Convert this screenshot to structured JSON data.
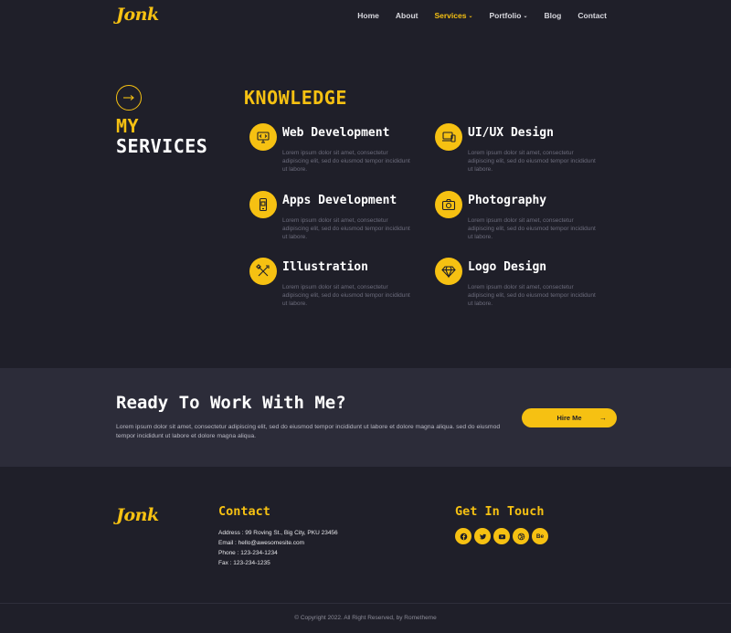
{
  "brand": {
    "logo": "Jonk",
    "accent": "#f6c112",
    "background": "#1f1f29"
  },
  "nav": {
    "items": [
      {
        "label": "Home",
        "active": false,
        "dropdown": false
      },
      {
        "label": "About",
        "active": false,
        "dropdown": false
      },
      {
        "label": "Services",
        "active": true,
        "dropdown": true
      },
      {
        "label": "Portfolio",
        "active": false,
        "dropdown": true
      },
      {
        "label": "Blog",
        "active": false,
        "dropdown": false
      },
      {
        "label": "Contact",
        "active": false,
        "dropdown": false
      }
    ]
  },
  "intro": {
    "line1": "MY",
    "line2": "SERVICES",
    "arrow_icon": "arrow-right-icon"
  },
  "knowledge": {
    "heading": "KNOWLEDGE",
    "services": [
      {
        "title": "Web Development",
        "icon": "monitor-code-icon",
        "desc": "Lorem ipsum dolor sit amet, consectetur adipiscing elit, sed do eiusmod tempor incididunt ut labore."
      },
      {
        "title": "UI/UX Design",
        "icon": "devices-icon",
        "desc": "Lorem ipsum dolor sit amet, consectetur adipiscing elit, sed do eiusmod tempor incididunt ut labore."
      },
      {
        "title": "Apps Development",
        "icon": "smartphone-icon",
        "desc": "Lorem ipsum dolor sit amet, consectetur adipiscing elit, sed do eiusmod tempor incididunt ut labore."
      },
      {
        "title": "Photography",
        "icon": "camera-icon",
        "desc": "Lorem ipsum dolor sit amet, consectetur adipiscing elit, sed do eiusmod tempor incididunt ut labore."
      },
      {
        "title": "Illustration",
        "icon": "pen-ruler-icon",
        "desc": "Lorem ipsum dolor sit amet, consectetur adipiscing elit, sed do eiusmod tempor incididunt ut labore."
      },
      {
        "title": "Logo Design",
        "icon": "diamond-icon",
        "desc": "Lorem ipsum dolor sit amet, consectetur adipiscing elit, sed do eiusmod tempor incididunt ut labore."
      }
    ]
  },
  "cta": {
    "title": "Ready To Work With Me?",
    "text": "Lorem ipsum dolor sit amet, consectetur adipiscing elit, sed do eiusmod tempor incididunt ut labore et dolore magna aliqua. sed do eiusmod tempor incididunt ut labore et dolore magna aliqua.",
    "button": "Hire Me"
  },
  "footer": {
    "logo": "Jonk",
    "contact_heading": "Contact",
    "contact_lines": [
      "Address : 99 Roving St., Big City, PKU 23456",
      "Email : hello@awesomesite.com",
      "Phone : 123-234-1234",
      "Fax : 123-234-1235"
    ],
    "touch_heading": "Get In Touch",
    "socials": [
      {
        "icon": "facebook-icon"
      },
      {
        "icon": "twitter-icon"
      },
      {
        "icon": "youtube-icon"
      },
      {
        "icon": "dribbble-icon"
      },
      {
        "icon": "behance-icon",
        "label": "Be"
      }
    ],
    "copyright": "© Copyright 2022. All Right Reserved, by Rometheme"
  }
}
